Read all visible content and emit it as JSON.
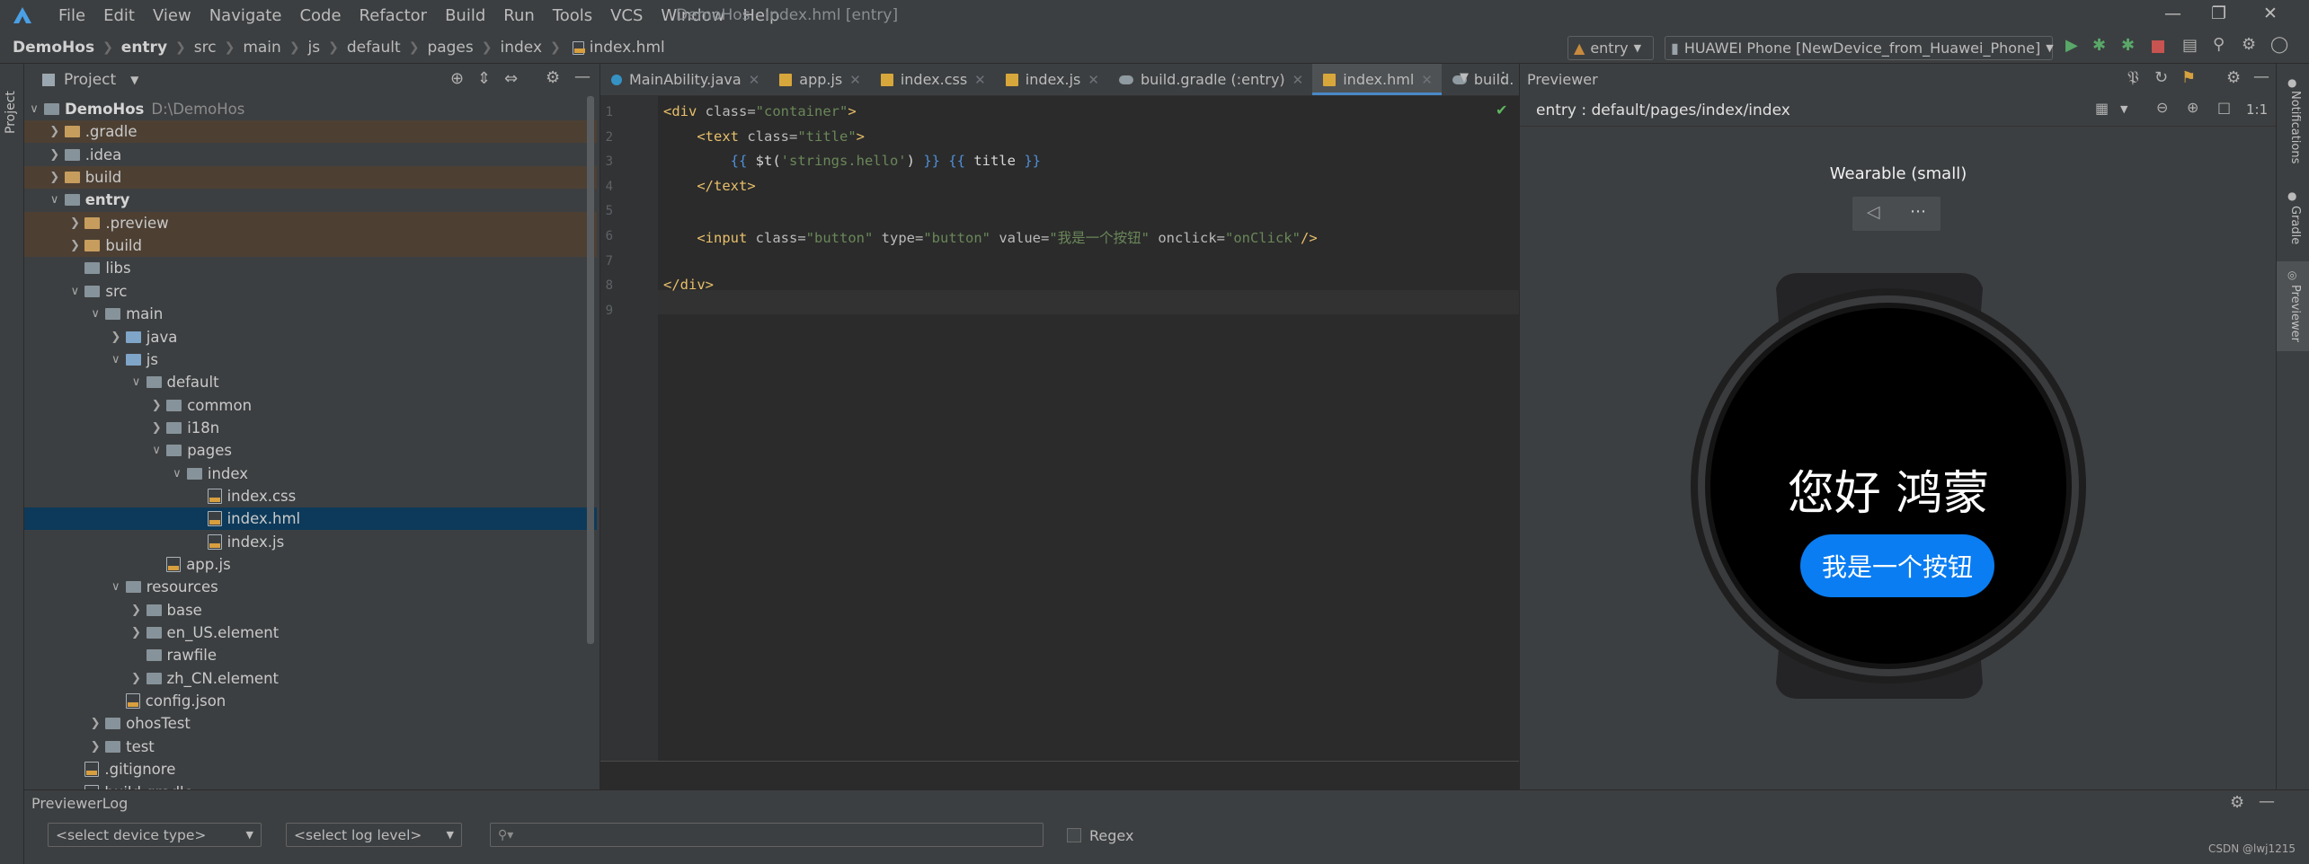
{
  "window": {
    "title": "DemoHos - index.hml [entry]",
    "menus": [
      "File",
      "Edit",
      "View",
      "Navigate",
      "Code",
      "Refactor",
      "Build",
      "Run",
      "Tools",
      "VCS",
      "Window",
      "Help"
    ]
  },
  "breadcrumbs": [
    "DemoHos",
    "entry",
    "src",
    "main",
    "js",
    "default",
    "pages",
    "index",
    "index.hml"
  ],
  "run_config": {
    "module": "entry",
    "device": "HUAWEI Phone [NewDevice_from_Huawei_Phone]"
  },
  "left_strip": {
    "label": "Project"
  },
  "project_panel": {
    "title": "Project",
    "tree": [
      {
        "label": "DemoHos",
        "path": "D:\\DemoHos",
        "depth": 0,
        "kind": "root",
        "open": true
      },
      {
        "label": ".gradle",
        "depth": 1,
        "kind": "folder",
        "open": false,
        "excluded": true
      },
      {
        "label": ".idea",
        "depth": 1,
        "kind": "folder",
        "open": false
      },
      {
        "label": "build",
        "depth": 1,
        "kind": "folder",
        "open": false,
        "excluded": true
      },
      {
        "label": "entry",
        "depth": 1,
        "kind": "module",
        "open": true
      },
      {
        "label": ".preview",
        "depth": 2,
        "kind": "folder",
        "open": false,
        "excluded": true
      },
      {
        "label": "build",
        "depth": 2,
        "kind": "folder",
        "open": false,
        "excluded": true
      },
      {
        "label": "libs",
        "depth": 2,
        "kind": "folder",
        "leaf": true
      },
      {
        "label": "src",
        "depth": 2,
        "kind": "folder",
        "open": true
      },
      {
        "label": "main",
        "depth": 3,
        "kind": "folder",
        "open": true
      },
      {
        "label": "java",
        "depth": 4,
        "kind": "srcfolder",
        "open": false
      },
      {
        "label": "js",
        "depth": 4,
        "kind": "srcfolder",
        "open": true
      },
      {
        "label": "default",
        "depth": 5,
        "kind": "folder",
        "open": true
      },
      {
        "label": "common",
        "depth": 6,
        "kind": "folder",
        "open": false
      },
      {
        "label": "i18n",
        "depth": 6,
        "kind": "folder",
        "open": false
      },
      {
        "label": "pages",
        "depth": 6,
        "kind": "folder",
        "open": true
      },
      {
        "label": "index",
        "depth": 7,
        "kind": "folder",
        "open": true
      },
      {
        "label": "index.css",
        "depth": 8,
        "kind": "file",
        "leaf": true
      },
      {
        "label": "index.hml",
        "depth": 8,
        "kind": "file",
        "leaf": true,
        "selected": true
      },
      {
        "label": "index.js",
        "depth": 8,
        "kind": "file",
        "leaf": true
      },
      {
        "label": "app.js",
        "depth": 6,
        "kind": "file",
        "leaf": true
      },
      {
        "label": "resources",
        "depth": 4,
        "kind": "folder",
        "open": true
      },
      {
        "label": "base",
        "depth": 5,
        "kind": "folder",
        "open": false
      },
      {
        "label": "en_US.element",
        "depth": 5,
        "kind": "folder",
        "open": false
      },
      {
        "label": "rawfile",
        "depth": 5,
        "kind": "folder",
        "leaf": true
      },
      {
        "label": "zh_CN.element",
        "depth": 5,
        "kind": "folder",
        "open": false
      },
      {
        "label": "config.json",
        "depth": 4,
        "kind": "file",
        "leaf": true
      },
      {
        "label": "ohosTest",
        "depth": 3,
        "kind": "folder",
        "open": false
      },
      {
        "label": "test",
        "depth": 3,
        "kind": "folder",
        "open": false
      },
      {
        "label": ".gitignore",
        "depth": 2,
        "kind": "file",
        "leaf": true
      },
      {
        "label": "build.gradle",
        "depth": 2,
        "kind": "file",
        "leaf": true
      }
    ]
  },
  "editor": {
    "tabs": [
      {
        "label": "MainAbility.java",
        "icon": "java"
      },
      {
        "label": "app.js",
        "icon": "js"
      },
      {
        "label": "index.css",
        "icon": "js"
      },
      {
        "label": "index.js",
        "icon": "js"
      },
      {
        "label": "build.gradle (:entry)",
        "icon": "gradle"
      },
      {
        "label": "index.hml",
        "icon": "js",
        "active": true
      },
      {
        "label": "build.",
        "icon": "gradle"
      }
    ],
    "lines": [
      {
        "n": "1",
        "parts": [
          [
            "tag",
            "<div "
          ],
          [
            "atn",
            "class="
          ],
          [
            "atv",
            "\"container\""
          ],
          [
            "tag",
            ">"
          ]
        ]
      },
      {
        "n": "2",
        "parts": [
          [
            "txt",
            "    "
          ],
          [
            "tag",
            "<text "
          ],
          [
            "atn",
            "class="
          ],
          [
            "atv",
            "\"title\""
          ],
          [
            "tag",
            ">"
          ]
        ]
      },
      {
        "n": "3",
        "parts": [
          [
            "txt",
            "        "
          ],
          [
            "mus",
            "{{ "
          ],
          [
            "txt",
            "$t("
          ],
          [
            "atv",
            "'strings.hello'"
          ],
          [
            "txt",
            ") "
          ],
          [
            "mus",
            "}} {{ "
          ],
          [
            "txt",
            "title "
          ],
          [
            "mus",
            "}}"
          ]
        ]
      },
      {
        "n": "4",
        "parts": [
          [
            "txt",
            "    "
          ],
          [
            "tag",
            "</text>"
          ]
        ]
      },
      {
        "n": "5",
        "parts": []
      },
      {
        "n": "6",
        "parts": [
          [
            "txt",
            "    "
          ],
          [
            "tag",
            "<input "
          ],
          [
            "atn",
            "class="
          ],
          [
            "atv",
            "\"button\" "
          ],
          [
            "atn",
            "type="
          ],
          [
            "atv",
            "\"button\" "
          ],
          [
            "atn",
            "value="
          ],
          [
            "atv",
            "\"我是一个按钮\" "
          ],
          [
            "atn",
            "onclick="
          ],
          [
            "atv",
            "\"onClick\""
          ],
          [
            "tag",
            "/>"
          ]
        ]
      },
      {
        "n": "7",
        "parts": []
      },
      {
        "n": "8",
        "parts": [
          [
            "tag",
            "</div>"
          ]
        ]
      },
      {
        "n": "9",
        "parts": []
      }
    ]
  },
  "previewer": {
    "title": "Previewer",
    "path": "entry : default/pages/index/index",
    "device_label": "Wearable (small)",
    "screen_text": "您好 鸿蒙",
    "button_text": "我是一个按钮",
    "zoom_label": "1:1"
  },
  "right_strip": [
    "Notifications",
    "Gradle",
    "Previewer"
  ],
  "bottom_panel": {
    "title": "PreviewerLog",
    "device_select": "<select device type>",
    "level_select": "<select log level>",
    "search_placeholder": "",
    "regex_label": "Regex"
  },
  "watermark": "CSDN @lwj1215",
  "colors": {
    "accent": "#4a88c7",
    "button_blue": "#0a7df2",
    "excluded_bg": "#4d4033",
    "selected_bg": "#0d3a5a"
  }
}
